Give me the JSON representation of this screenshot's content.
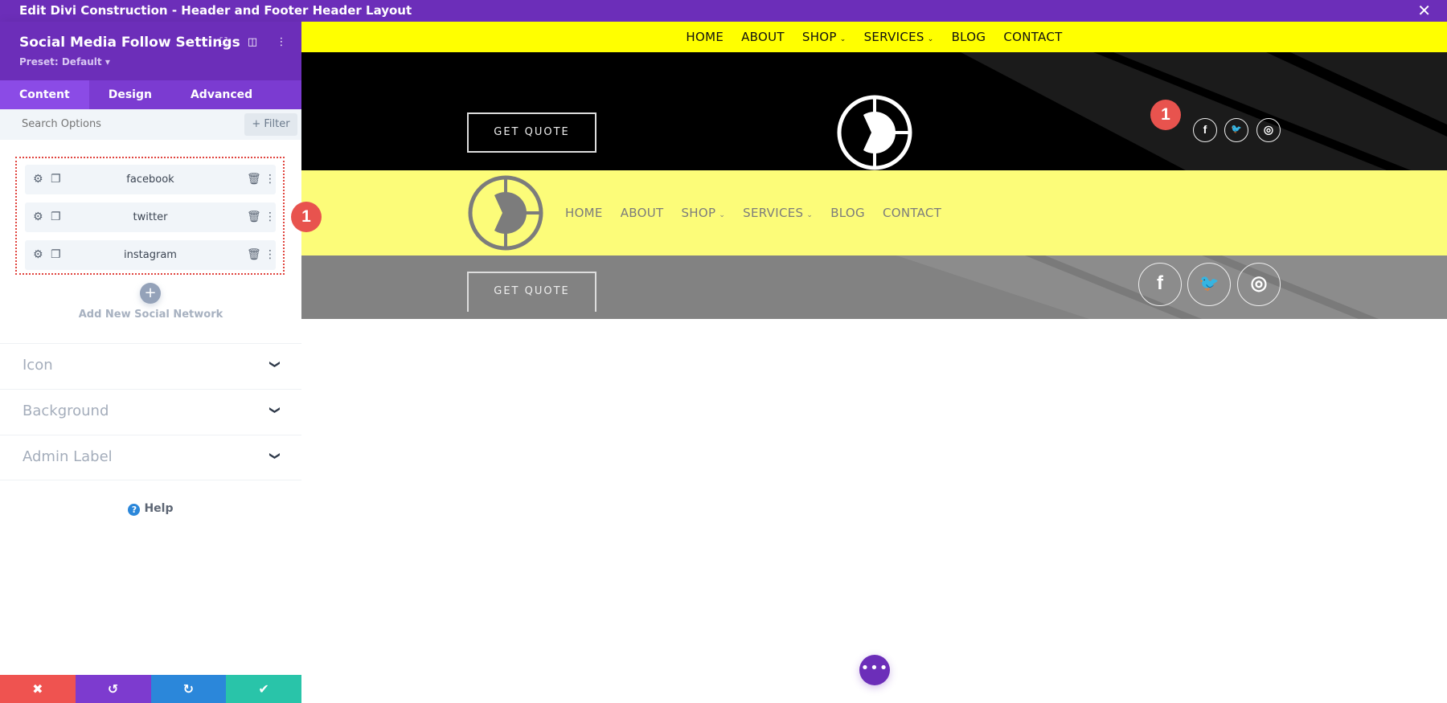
{
  "window": {
    "title": "Edit Divi Construction - Header and Footer Header Layout",
    "close_icon": "close-icon"
  },
  "sidebar": {
    "title": "Social Media Follow Settings",
    "preset": "Preset: Default ▾",
    "header_icons": [
      "fullscreen-icon",
      "split-view-icon",
      "more-options-icon"
    ],
    "tabs": [
      {
        "label": "Content",
        "active": true
      },
      {
        "label": "Design"
      },
      {
        "label": "Advanced"
      }
    ],
    "search": {
      "placeholder": "Search Options",
      "value": ""
    },
    "filter_label": "+ Filter",
    "networks": [
      {
        "label": "facebook"
      },
      {
        "label": "twitter"
      },
      {
        "label": "instagram"
      }
    ],
    "add_label": "Add New Social Network",
    "add_symbol": "+",
    "accordions": [
      {
        "label": "Icon"
      },
      {
        "label": "Background"
      },
      {
        "label": "Admin Label"
      }
    ],
    "help_label": "Help",
    "bottom_actions": [
      {
        "name": "discard",
        "glyph": "✖",
        "color": "#ef5350"
      },
      {
        "name": "undo",
        "glyph": "↺",
        "color": "#7d3bcf"
      },
      {
        "name": "redo",
        "glyph": "↻",
        "color": "#2b87da"
      },
      {
        "name": "save",
        "glyph": "✔",
        "color": "#29c4a9"
      }
    ]
  },
  "annotation": {
    "badge": "1",
    "color": "#e8534e"
  },
  "canvas": {
    "top_nav": [
      "HOME",
      "ABOUT",
      "SHOP",
      "SERVICES",
      "BLOG",
      "CONTACT"
    ],
    "dropdown_glyph": "⌄",
    "get_quote": "GET QUOTE",
    "social": [
      {
        "name": "facebook",
        "glyph": "f"
      },
      {
        "name": "twitter",
        "glyph": "🐦"
      },
      {
        "name": "instagram",
        "glyph": "◎"
      }
    ],
    "yellow_nav": [
      "HOME",
      "ABOUT",
      "SHOP",
      "SERVICES",
      "BLOG",
      "CONTACT"
    ],
    "fab_glyph": "•••",
    "colors": {
      "accent": "#6c2eb9",
      "nav_yellow": "#ffff00",
      "pale_yellow": "#fcfc79",
      "gray": "#828282"
    }
  }
}
